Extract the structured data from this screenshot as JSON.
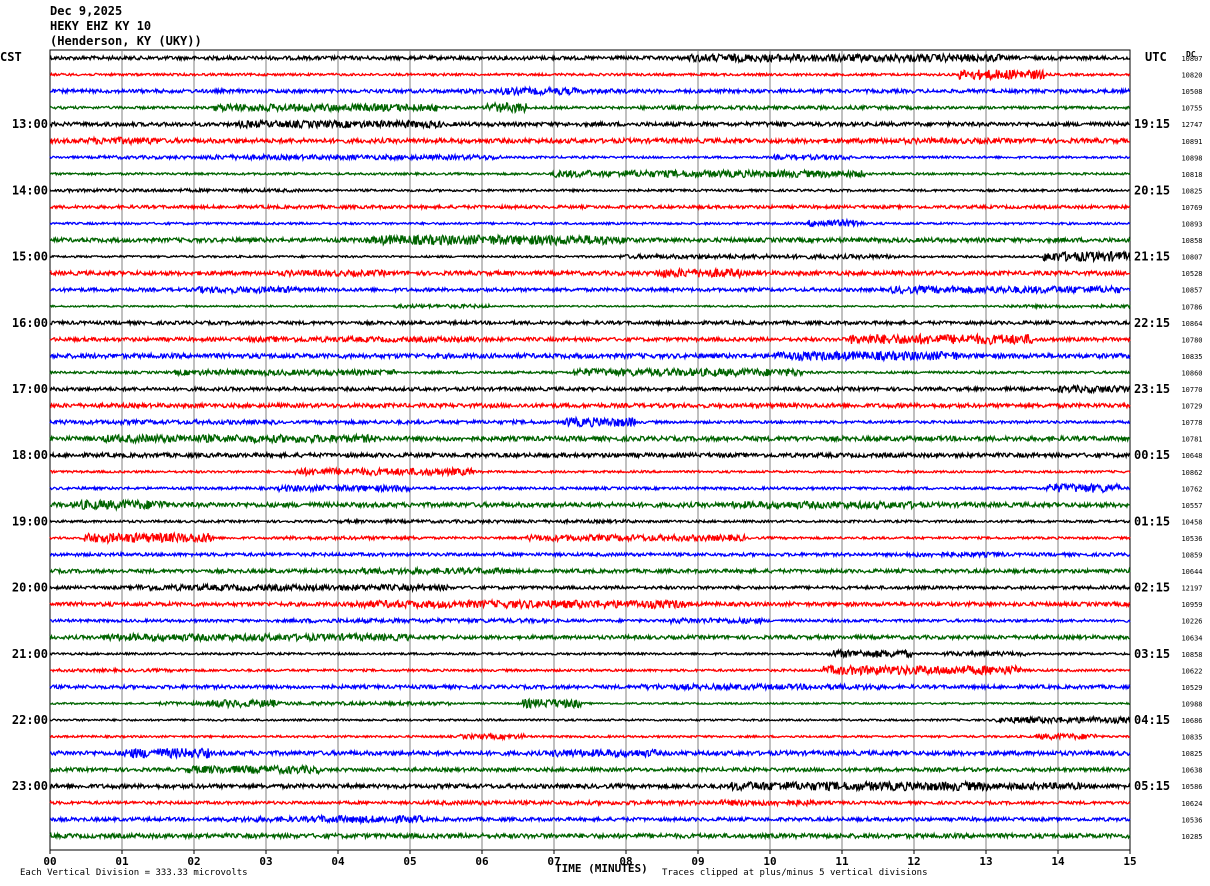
{
  "header": {
    "date": "Dec 9,2025",
    "station": "HEKY EHZ KY 10",
    "location": "(Henderson, KY (UKY))"
  },
  "axis_labels": {
    "left_timezone": "CST",
    "right_timezone": "UTC",
    "right_column_label": "DC",
    "xlabel": "TIME (MINUTES)"
  },
  "footer": {
    "scale_note": "Each Vertical Division =  333.33 microvolts",
    "clip_note": "Traces clipped at plus/minus 5 vertical divisions"
  },
  "colors": {
    "trace_cycle": [
      "#000000",
      "#ff0000",
      "#0000ff",
      "#006400"
    ],
    "grid": "#808080"
  },
  "chart_data": {
    "type": "line",
    "description_kind": "helicorder seismogram",
    "x": [
      0,
      1,
      2,
      3,
      4,
      5,
      6,
      7,
      8,
      9,
      10,
      11,
      12,
      13,
      14,
      15
    ],
    "xtick_labels": [
      "00",
      "01",
      "02",
      "03",
      "04",
      "05",
      "06",
      "07",
      "08",
      "09",
      "10",
      "11",
      "12",
      "13",
      "14",
      "15"
    ],
    "xlim": [
      0,
      15
    ],
    "minutes_per_line": 15,
    "line_count": 48,
    "left_hour_labels": [
      "13:00",
      "14:00",
      "15:00",
      "16:00",
      "17:00",
      "18:00",
      "19:00",
      "20:00",
      "21:00",
      "22:00",
      "23:00"
    ],
    "right_hour_labels": [
      "19:15",
      "20:15",
      "21:15",
      "22:15",
      "23:15",
      "00:15",
      "01:15",
      "02:15",
      "03:15",
      "04:15",
      "05:15"
    ],
    "hour_label_first_line": 4,
    "dc_offsets": [
      "10807",
      "10820",
      "10508",
      "10755",
      "12747",
      "10891",
      "10898",
      "10818",
      "10825",
      "10769",
      "10893",
      "10858",
      "10807",
      "10528",
      "10857",
      "10786",
      "10864",
      "10780",
      "10835",
      "10860",
      "10770",
      "10729",
      "10778",
      "10781",
      "10648",
      "10862",
      "10762",
      "10557",
      "10458",
      "10536",
      "10859",
      "10644",
      "12197",
      "10959",
      "10226",
      "10634",
      "10858",
      "10622",
      "10529",
      "10988",
      "10686",
      "10835",
      "10825",
      "10638",
      "10586",
      "10624",
      "10536",
      "10285"
    ]
  }
}
